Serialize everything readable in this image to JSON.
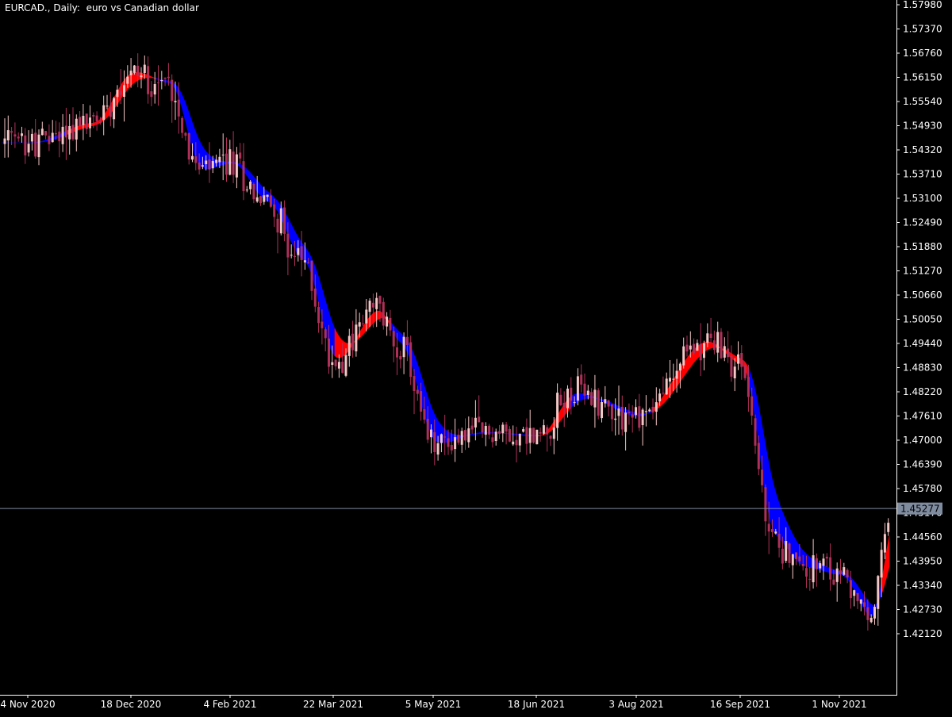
{
  "window": {
    "symbol": "EURCAD.",
    "timeframe": "Daily",
    "description": "euro vs Canadian dollar"
  },
  "colors": {
    "background": "#000000",
    "axis": "#ffffff",
    "candle_bull": "#f5c6c6",
    "candle_bear": "#b0305a",
    "band_bull": "#ff0000",
    "band_bear": "#0000ff",
    "current_line": "#7f8ca0",
    "price_tag": "#7f8ca0"
  },
  "chart_data": {
    "type": "candlestick",
    "title": "EURCAD., Daily:  euro vs Canadian dollar",
    "y_ticks": [
      "1.57980",
      "1.57370",
      "1.56760",
      "1.56150",
      "1.55540",
      "1.54930",
      "1.54320",
      "1.53710",
      "1.53100",
      "1.52490",
      "1.51880",
      "1.51270",
      "1.50660",
      "1.50050",
      "1.49440",
      "1.48830",
      "1.48220",
      "1.47610",
      "1.47000",
      "1.46390",
      "1.45780",
      "1.45170",
      "1.44560",
      "1.43950",
      "1.43340",
      "1.42730",
      "1.42120"
    ],
    "ylim": [
      1.4175,
      1.58
    ],
    "x_ticks": [
      "4 Nov 2020",
      "18 Dec 2020",
      "4 Feb 2021",
      "22 Mar 2021",
      "5 May 2021",
      "18 Jun 2021",
      "3 Aug 2021",
      "16 Sep 2021",
      "1 Nov 2021"
    ],
    "current_price": "1.45277",
    "current_price_value": 1.45277,
    "close_path": [
      [
        "4 Nov 2020",
        1.545
      ],
      [
        "1 Dec 2020",
        1.55
      ],
      [
        "18 Dec 2020",
        1.563
      ],
      [
        "5 Jan 2021",
        1.56
      ],
      [
        "20 Jan 2021",
        1.538
      ],
      [
        "4 Feb 2021",
        1.54
      ],
      [
        "20 Feb 2021",
        1.53
      ],
      [
        "8 Mar 2021",
        1.515
      ],
      [
        "22 Mar 2021",
        1.49
      ],
      [
        "10 Apr 2021",
        1.503
      ],
      [
        "20 Apr 2021",
        1.494
      ],
      [
        "5 May 2021",
        1.469
      ],
      [
        "25 May 2021",
        1.472
      ],
      [
        "18 Jun 2021",
        1.471
      ],
      [
        "5 Jul 2021",
        1.482
      ],
      [
        "3 Aug 2021",
        1.476
      ],
      [
        "1 Sep 2021",
        1.495
      ],
      [
        "16 Sep 2021",
        1.489
      ],
      [
        "1 Oct 2021",
        1.445
      ],
      [
        "15 Oct 2021",
        1.438
      ],
      [
        "1 Nov 2021",
        1.436
      ],
      [
        "15 Nov 2021",
        1.425
      ],
      [
        "26 Nov 2021",
        1.4527
      ]
    ],
    "band_segments": [
      [
        "4 Nov 2020",
        "bear"
      ],
      [
        "20 Nov 2020",
        "bull"
      ],
      [
        "30 Dec 2020",
        "bear"
      ],
      [
        "22 Mar 2021",
        "bull"
      ],
      [
        "15 Apr 2021",
        "bear"
      ],
      [
        "18 Jun 2021",
        "bull"
      ],
      [
        "3 Jul 2021",
        "bear"
      ],
      [
        "10 Aug 2021",
        "bull"
      ],
      [
        "20 Sep 2021",
        "bear"
      ],
      [
        "20 Nov 2021",
        "bull"
      ]
    ],
    "grid": false,
    "legend": "none"
  }
}
